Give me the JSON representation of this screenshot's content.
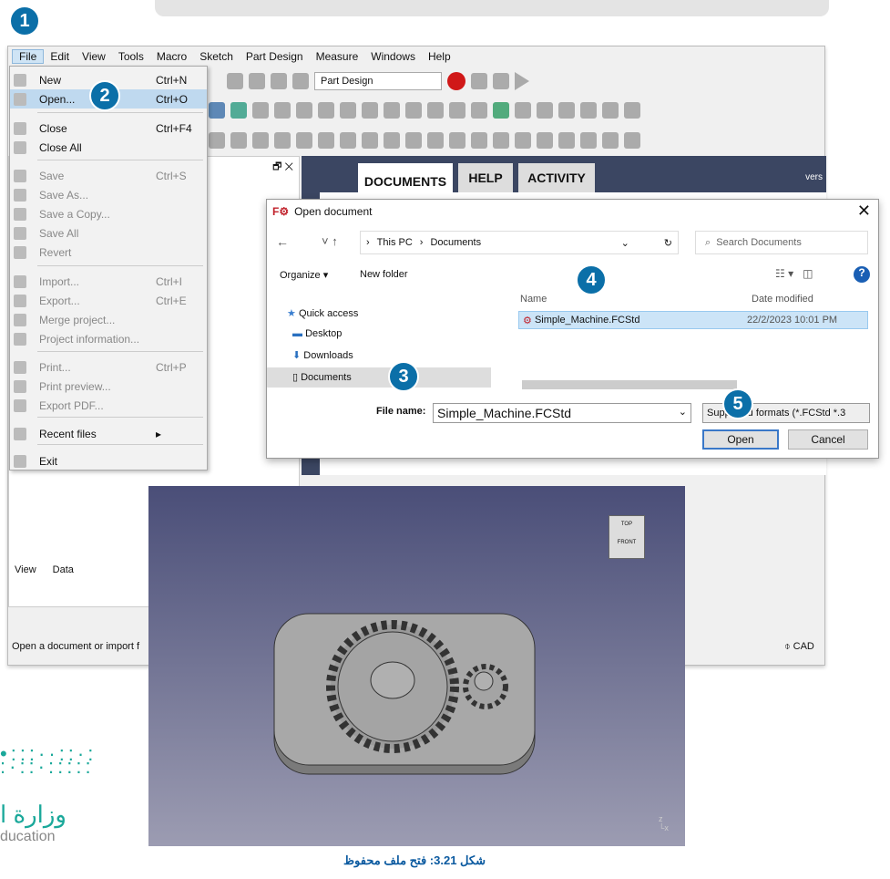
{
  "steps": [
    "1",
    "2",
    "3",
    "4",
    "5"
  ],
  "menubar": [
    "File",
    "Edit",
    "View",
    "Tools",
    "Macro",
    "Sketch",
    "Part Design",
    "Measure",
    "Windows",
    "Help"
  ],
  "workbench": "Part Design",
  "file_menu": [
    {
      "label": "New",
      "shortcut": "Ctrl+N",
      "enabled": true
    },
    {
      "label": "Open...",
      "shortcut": "Ctrl+O",
      "enabled": true,
      "highlighted": true
    },
    {
      "label": "Close",
      "shortcut": "Ctrl+F4",
      "enabled": true
    },
    {
      "label": "Close All",
      "shortcut": "",
      "enabled": true
    },
    {
      "label": "Save",
      "shortcut": "Ctrl+S",
      "enabled": false
    },
    {
      "label": "Save As...",
      "shortcut": "",
      "enabled": false
    },
    {
      "label": "Save a Copy...",
      "shortcut": "",
      "enabled": false
    },
    {
      "label": "Save All",
      "shortcut": "",
      "enabled": false
    },
    {
      "label": "Revert",
      "shortcut": "",
      "enabled": false
    },
    {
      "label": "Import...",
      "shortcut": "Ctrl+I",
      "enabled": false
    },
    {
      "label": "Export...",
      "shortcut": "Ctrl+E",
      "enabled": false
    },
    {
      "label": "Merge project...",
      "shortcut": "",
      "enabled": false
    },
    {
      "label": "Project information...",
      "shortcut": "",
      "enabled": false
    },
    {
      "label": "Print...",
      "shortcut": "Ctrl+P",
      "enabled": false
    },
    {
      "label": "Print preview...",
      "shortcut": "",
      "enabled": false
    },
    {
      "label": "Export PDF...",
      "shortcut": "",
      "enabled": false
    },
    {
      "label": "Recent files",
      "shortcut": "▸",
      "enabled": true
    },
    {
      "label": "Exit",
      "shortcut": "",
      "enabled": true
    }
  ],
  "start_tabs": [
    "DOCUMENTS",
    "HELP",
    "ACTIVITY"
  ],
  "version_text": "vers",
  "panel_tabs": [
    "View",
    "Data"
  ],
  "status": "Open a document or import f",
  "nav_style": "CAD",
  "dialog": {
    "title": "Open document",
    "breadcrumb": [
      "This PC",
      "Documents"
    ],
    "search_placeholder": "Search Documents",
    "organize": "Organize ▾",
    "new_folder": "New folder",
    "nav": [
      "Quick access",
      "Desktop",
      "Downloads",
      "Documents"
    ],
    "columns": [
      "Name",
      "Date modified"
    ],
    "files": [
      {
        "name": "Simple_Machine.FCStd",
        "date": "22/2/2023 10:01 PM"
      }
    ],
    "file_name_label": "File name:",
    "file_name": "Simple_Machine.FCStd",
    "filter": "Supported formats (*.FCStd *.3",
    "open": "Open",
    "cancel": "Cancel"
  },
  "navcube": {
    "top": "TOP",
    "front": "FRONT"
  },
  "logo": {
    "arabic": "وزارة ا",
    "english": "ducation"
  },
  "caption": "شكل 3.21: فتح ملف محفوظ",
  "colors": {
    "badge": "#0b6fa8",
    "main_bg": "#3b4662",
    "selection": "#cce4f7"
  }
}
